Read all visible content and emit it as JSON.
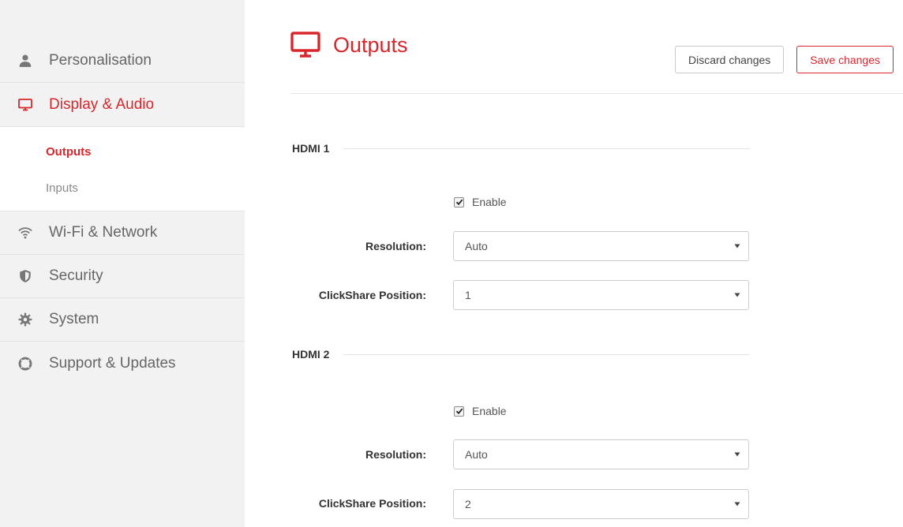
{
  "sidebar": {
    "items": [
      {
        "label": "Personalisation",
        "icon": "user-icon"
      },
      {
        "label": "Display & Audio",
        "icon": "monitor-icon",
        "active": true,
        "children": [
          {
            "label": "Outputs",
            "active": true
          },
          {
            "label": "Inputs"
          }
        ]
      },
      {
        "label": "Wi-Fi & Network",
        "icon": "wifi-icon"
      },
      {
        "label": "Security",
        "icon": "shield-icon"
      },
      {
        "label": "System",
        "icon": "gear-icon"
      },
      {
        "label": "Support & Updates",
        "icon": "lifebuoy-icon"
      }
    ]
  },
  "header": {
    "title": "Outputs",
    "icon": "monitor-icon",
    "discard_label": "Discard changes",
    "save_label": "Save changes"
  },
  "sections": [
    {
      "title": "HDMI 1",
      "enable_label": "Enable",
      "enabled": true,
      "resolution_label": "Resolution:",
      "resolution_value": "Auto",
      "position_label": "ClickShare Position:",
      "position_value": "1"
    },
    {
      "title": "HDMI 2",
      "enable_label": "Enable",
      "enabled": true,
      "resolution_label": "Resolution:",
      "resolution_value": "Auto",
      "position_label": "ClickShare Position:",
      "position_value": "2"
    }
  ],
  "colors": {
    "accent": "#d8262c",
    "sidebar_bg": "#f2f2f2",
    "text": "#555555"
  }
}
